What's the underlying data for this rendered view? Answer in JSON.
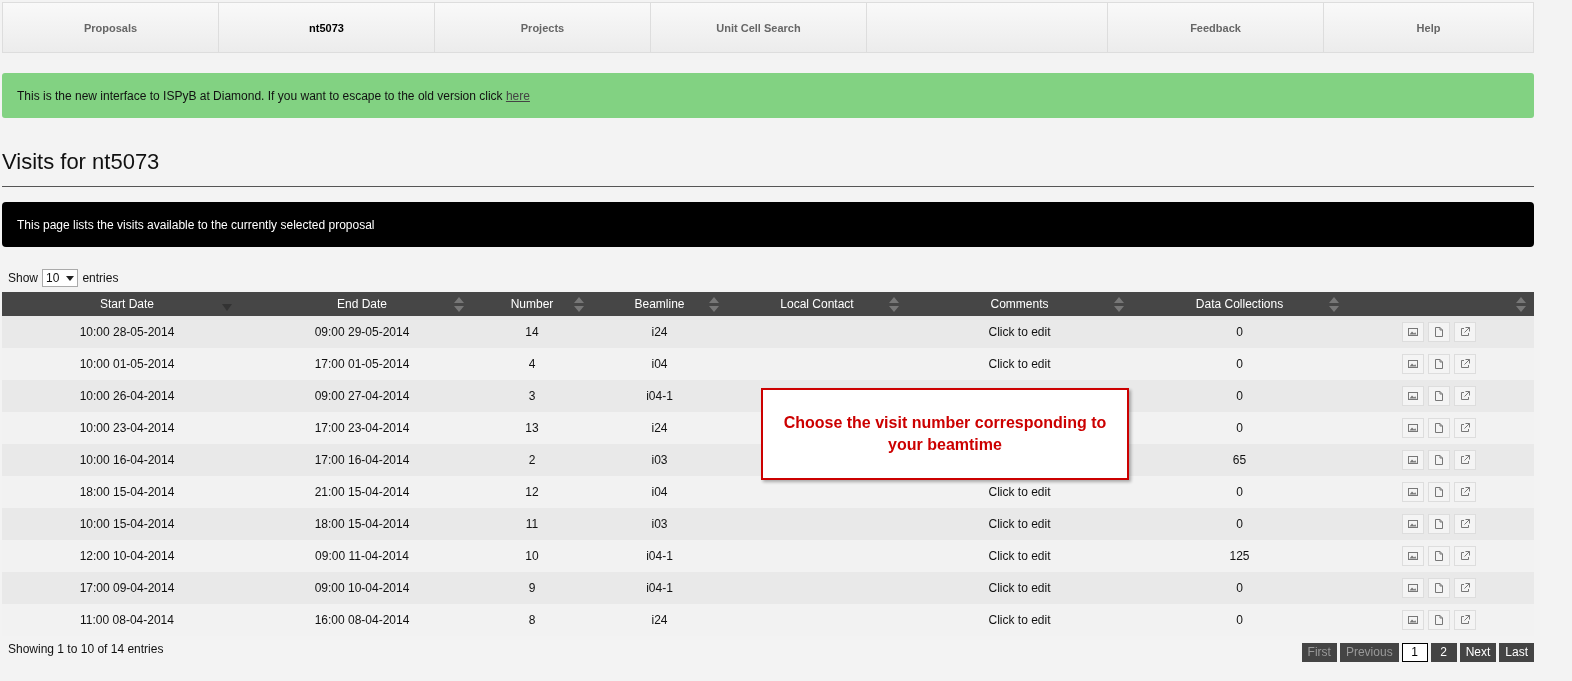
{
  "nav": {
    "tabs": [
      {
        "label": "Proposals",
        "selected": false
      },
      {
        "label": "nt5073",
        "selected": true
      },
      {
        "label": "Projects",
        "selected": false
      },
      {
        "label": "Unit Cell Search",
        "selected": false
      },
      {
        "label": "Feedback",
        "selected": false
      },
      {
        "label": "Help",
        "selected": false
      }
    ]
  },
  "alert": {
    "text": "This is the new interface to ISPyB at Diamond. If you want to escape to the old version click ",
    "link": "here"
  },
  "heading": "Visits for nt5073",
  "info": "This page lists the visits available to the currently selected proposal",
  "length": {
    "before": "Show",
    "value": "10",
    "after": "entries"
  },
  "table": {
    "columns": [
      {
        "label": "Start Date",
        "sorted": true
      },
      {
        "label": "End Date",
        "sorted": false
      },
      {
        "label": "Number",
        "sorted": false
      },
      {
        "label": "Beamline",
        "sorted": false
      },
      {
        "label": "Local Contact",
        "sorted": false
      },
      {
        "label": "Comments",
        "sorted": false
      },
      {
        "label": "Data Collections",
        "sorted": false
      },
      {
        "sorted": false
      }
    ],
    "rows": [
      {
        "start": "10:00 28-05-2014",
        "end": "09:00 29-05-2014",
        "number": "14",
        "beamline": "i24",
        "comments": "Click to edit",
        "collections": "0"
      },
      {
        "start": "10:00 01-05-2014",
        "end": "17:00 01-05-2014",
        "number": "4",
        "beamline": "i04",
        "comments": "Click to edit",
        "collections": "0"
      },
      {
        "start": "10:00 26-04-2014",
        "end": "09:00 27-04-2014",
        "number": "3",
        "beamline": "i04-1",
        "collections": "0"
      },
      {
        "start": "10:00 23-04-2014",
        "end": "17:00 23-04-2014",
        "number": "13",
        "beamline": "i24",
        "collections": "0"
      },
      {
        "start": "10:00 16-04-2014",
        "end": "17:00 16-04-2014",
        "number": "2",
        "beamline": "i03",
        "collections": "65"
      },
      {
        "start": "18:00 15-04-2014",
        "end": "21:00 15-04-2014",
        "number": "12",
        "beamline": "i04",
        "comments": "Click to edit",
        "collections": "0"
      },
      {
        "start": "10:00 15-04-2014",
        "end": "18:00 15-04-2014",
        "number": "11",
        "beamline": "i03",
        "comments": "Click to edit",
        "collections": "0"
      },
      {
        "start": "12:00 10-04-2014",
        "end": "09:00 11-04-2014",
        "number": "10",
        "beamline": "i04-1",
        "comments": "Click to edit",
        "collections": "125"
      },
      {
        "start": "17:00 09-04-2014",
        "end": "09:00 10-04-2014",
        "number": "9",
        "beamline": "i04-1",
        "comments": "Click to edit",
        "collections": "0"
      },
      {
        "start": "11:00 08-04-2014",
        "end": "16:00 08-04-2014",
        "number": "8",
        "beamline": "i24",
        "comments": "Click to edit",
        "collections": "0"
      }
    ]
  },
  "callout": "Choose the visit number corresponding to your beamtime",
  "summary": "Showing 1 to 10 of 14 entries",
  "pagination": [
    {
      "label": "First",
      "kind": "nav",
      "disabled": true,
      "selected": false
    },
    {
      "label": "Previous",
      "kind": "nav",
      "disabled": true,
      "selected": false
    },
    {
      "label": "1",
      "kind": "page",
      "disabled": false,
      "selected": true
    },
    {
      "label": "2",
      "kind": "page",
      "disabled": false,
      "selected": false
    },
    {
      "label": "Next",
      "kind": "nav",
      "disabled": false,
      "selected": false
    },
    {
      "label": "Last",
      "kind": "nav",
      "disabled": false,
      "selected": false
    }
  ]
}
